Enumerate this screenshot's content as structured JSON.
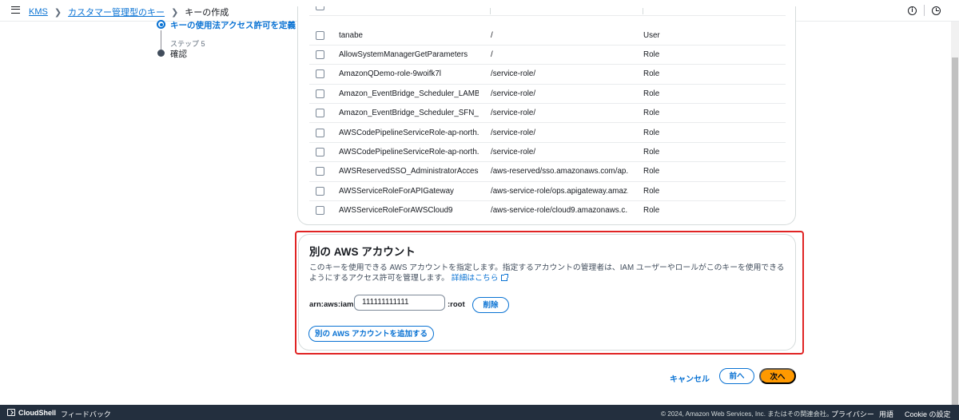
{
  "breadcrumb": {
    "items": [
      "KMS",
      "カスタマー管理型のキー"
    ],
    "current": "キーの作成"
  },
  "steps": {
    "current_label": "キーの使用法アクセス許可を定義",
    "next_step_number": "ステップ 5",
    "next_label": "確認"
  },
  "users_table": {
    "rows": [
      {
        "name": "tanabe",
        "path": "/",
        "type": "User"
      },
      {
        "name": "AllowSystemManagerGetParameters",
        "path": "/",
        "type": "Role"
      },
      {
        "name": "AmazonQDemo-role-9woifk7l",
        "path": "/service-role/",
        "type": "Role"
      },
      {
        "name": "Amazon_EventBridge_Scheduler_LAMB...",
        "path": "/service-role/",
        "type": "Role"
      },
      {
        "name": "Amazon_EventBridge_Scheduler_SFN_f...",
        "path": "/service-role/",
        "type": "Role"
      },
      {
        "name": "AWSCodePipelineServiceRole-ap-north...",
        "path": "/service-role/",
        "type": "Role"
      },
      {
        "name": "AWSCodePipelineServiceRole-ap-north...",
        "path": "/service-role/",
        "type": "Role"
      },
      {
        "name": "AWSReservedSSO_AdministratorAccess...",
        "path": "/aws-reserved/sso.amazonaws.com/ap...",
        "type": "Role"
      },
      {
        "name": "AWSServiceRoleForAPIGateway",
        "path": "/aws-service-role/ops.apigateway.amaz...",
        "type": "Role"
      },
      {
        "name": "AWSServiceRoleForAWSCloud9",
        "path": "/aws-service-role/cloud9.amazonaws.c...",
        "type": "Role"
      }
    ]
  },
  "other_accounts": {
    "title": "別の AWS アカウント",
    "description": "このキーを使用できる AWS アカウントを指定します。指定するアカウントの管理者は、IAM ユーザーやロールがこのキーを使用できるようにするアクセス許可を管理します。",
    "learn_more": "詳細はこちら",
    "arn_prefix": "arn:aws:iam::",
    "account_value": "111111111111",
    "arn_suffix": ":root",
    "remove_label": "削除",
    "add_label": "別の AWS アカウントを追加する"
  },
  "actions": {
    "cancel": "キャンセル",
    "previous": "前へ",
    "next": "次へ"
  },
  "footer": {
    "cloudshell": "CloudShell",
    "feedback": "フィードバック",
    "copyright": "© 2024, Amazon Web Services, Inc. またはその関連会社。",
    "privacy": "プライバシー",
    "terms": "用語",
    "cookie": "Cookie の設定"
  },
  "colors": {
    "link": "#0972d3",
    "primary_button": "#ff9900",
    "highlight": "#e02424",
    "footer_bg": "#232f3e"
  }
}
